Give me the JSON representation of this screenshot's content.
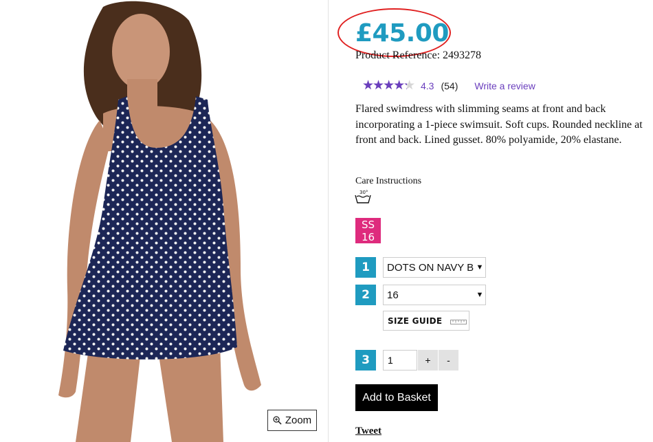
{
  "product": {
    "price": "£45.00",
    "reference": "Product Reference: 2493278",
    "description": "Flared swimdress with slimming seams at front and back incorporating a 1-piece swimsuit. Soft cups. Rounded neckline at front and back. Lined gusset. 80% polyamide, 20% elastane."
  },
  "rating": {
    "value": "4.3",
    "fraction": 0.86,
    "count": "(54)",
    "write_review": "Write a review",
    "star_color": "#6a3ebd"
  },
  "care": {
    "title": "Care Instructions",
    "icon": "wash-30-icon",
    "temp": "30°"
  },
  "badge": {
    "line1": "SS",
    "line2": "16",
    "color": "#de2b7d"
  },
  "options": {
    "steps": [
      "1",
      "2",
      "3"
    ],
    "colour_value": "DOTS ON NAVY BLUE",
    "size_value": "16",
    "size_guide": "SIZE GUIDE",
    "quantity": "1",
    "plus": "+",
    "minus": "-"
  },
  "actions": {
    "zoom": "Zoom",
    "add_to_basket": "Add to Basket",
    "tweet": "Tweet"
  },
  "colors": {
    "accent": "#1f9bc0",
    "highlight_circle": "#e02020",
    "dress_navy": "#1c2656"
  }
}
